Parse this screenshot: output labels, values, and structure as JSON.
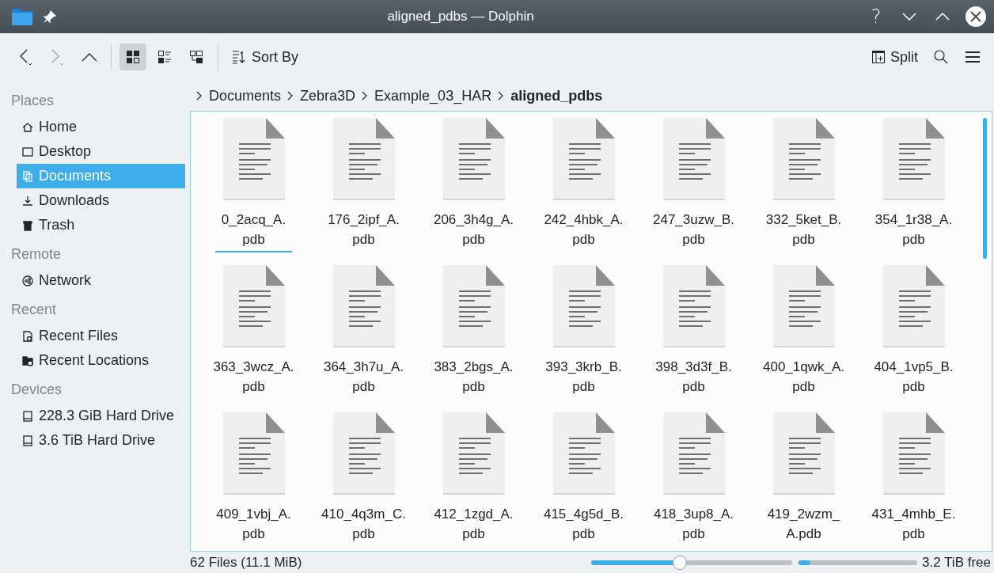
{
  "window": {
    "title": "aligned_pdbs — Dolphin",
    "controls": [
      "?"
    ]
  },
  "toolbar": {
    "view_buttons": [
      {
        "kind": "icons",
        "selected": true
      },
      {
        "kind": "compact",
        "selected": false
      },
      {
        "kind": "details",
        "selected": false
      }
    ],
    "sort_label": "Sort By",
    "split_label": "Split"
  },
  "sidebar": {
    "sections": [
      {
        "title": "Places",
        "items": [
          {
            "label": "Home",
            "kind": "home",
            "selected": false
          },
          {
            "label": "Desktop",
            "kind": "desktop",
            "selected": false
          },
          {
            "label": "Documents",
            "kind": "documents",
            "selected": true
          },
          {
            "label": "Downloads",
            "kind": "downloads",
            "selected": false
          },
          {
            "label": "Trash",
            "kind": "trash",
            "selected": false
          }
        ]
      },
      {
        "title": "Remote",
        "items": [
          {
            "label": "Network",
            "kind": "network",
            "selected": false
          }
        ]
      },
      {
        "title": "Recent",
        "items": [
          {
            "label": "Recent Files",
            "kind": "recent-files",
            "selected": false
          },
          {
            "label": "Recent Locations",
            "kind": "recent-locations",
            "selected": false
          }
        ]
      },
      {
        "title": "Devices",
        "items": [
          {
            "label": "228.3 GiB Hard Drive",
            "kind": "drive",
            "selected": false
          },
          {
            "label": "3.6 TiB Hard Drive",
            "kind": "drive",
            "selected": false
          }
        ]
      }
    ]
  },
  "breadcrumb": [
    {
      "label": "Documents",
      "current": false
    },
    {
      "label": "Zebra3D",
      "current": false
    },
    {
      "label": "Example_03_HAR",
      "current": false
    },
    {
      "label": "aligned_pdbs",
      "current": true
    }
  ],
  "files": [
    {
      "lines": [
        "0_2acq_A.",
        "pdb"
      ],
      "focused": true
    },
    {
      "lines": [
        "176_2ipf_A.",
        "pdb"
      ],
      "focused": false
    },
    {
      "lines": [
        "206_3h4g_A.",
        "pdb"
      ],
      "focused": false
    },
    {
      "lines": [
        "242_4hbk_A.",
        "pdb"
      ],
      "focused": false
    },
    {
      "lines": [
        "247_3uzw_B.",
        "pdb"
      ],
      "focused": false
    },
    {
      "lines": [
        "332_5ket_B.",
        "pdb"
      ],
      "focused": false
    },
    {
      "lines": [
        "354_1r38_A.",
        "pdb"
      ],
      "focused": false
    },
    {
      "lines": [
        "363_3wcz_A.",
        "pdb"
      ],
      "focused": false
    },
    {
      "lines": [
        "364_3h7u_A.",
        "pdb"
      ],
      "focused": false
    },
    {
      "lines": [
        "383_2bgs_A.",
        "pdb"
      ],
      "focused": false
    },
    {
      "lines": [
        "393_3krb_B.",
        "pdb"
      ],
      "focused": false
    },
    {
      "lines": [
        "398_3d3f_B.",
        "pdb"
      ],
      "focused": false
    },
    {
      "lines": [
        "400_1qwk_A.",
        "pdb"
      ],
      "focused": false
    },
    {
      "lines": [
        "404_1vp5_B.",
        "pdb"
      ],
      "focused": false
    },
    {
      "lines": [
        "409_1vbj_A.",
        "pdb"
      ],
      "focused": false
    },
    {
      "lines": [
        "410_4q3m_C.",
        "pdb"
      ],
      "focused": false
    },
    {
      "lines": [
        "412_1zgd_A.",
        "pdb"
      ],
      "focused": false
    },
    {
      "lines": [
        "415_4g5d_B.",
        "pdb"
      ],
      "focused": false
    },
    {
      "lines": [
        "418_3up8_A.",
        "pdb"
      ],
      "focused": false
    },
    {
      "lines": [
        "419_2wzm_",
        "A.pdb"
      ],
      "focused": false
    },
    {
      "lines": [
        "431_4mhb_E.",
        "pdb"
      ],
      "focused": false
    }
  ],
  "status_bar": {
    "summary": "62 Files (11.1 MiB)",
    "zoom": {
      "level": 0.44
    },
    "disk": {
      "level": 0.1
    },
    "free_space": "3.2 TiB free"
  }
}
